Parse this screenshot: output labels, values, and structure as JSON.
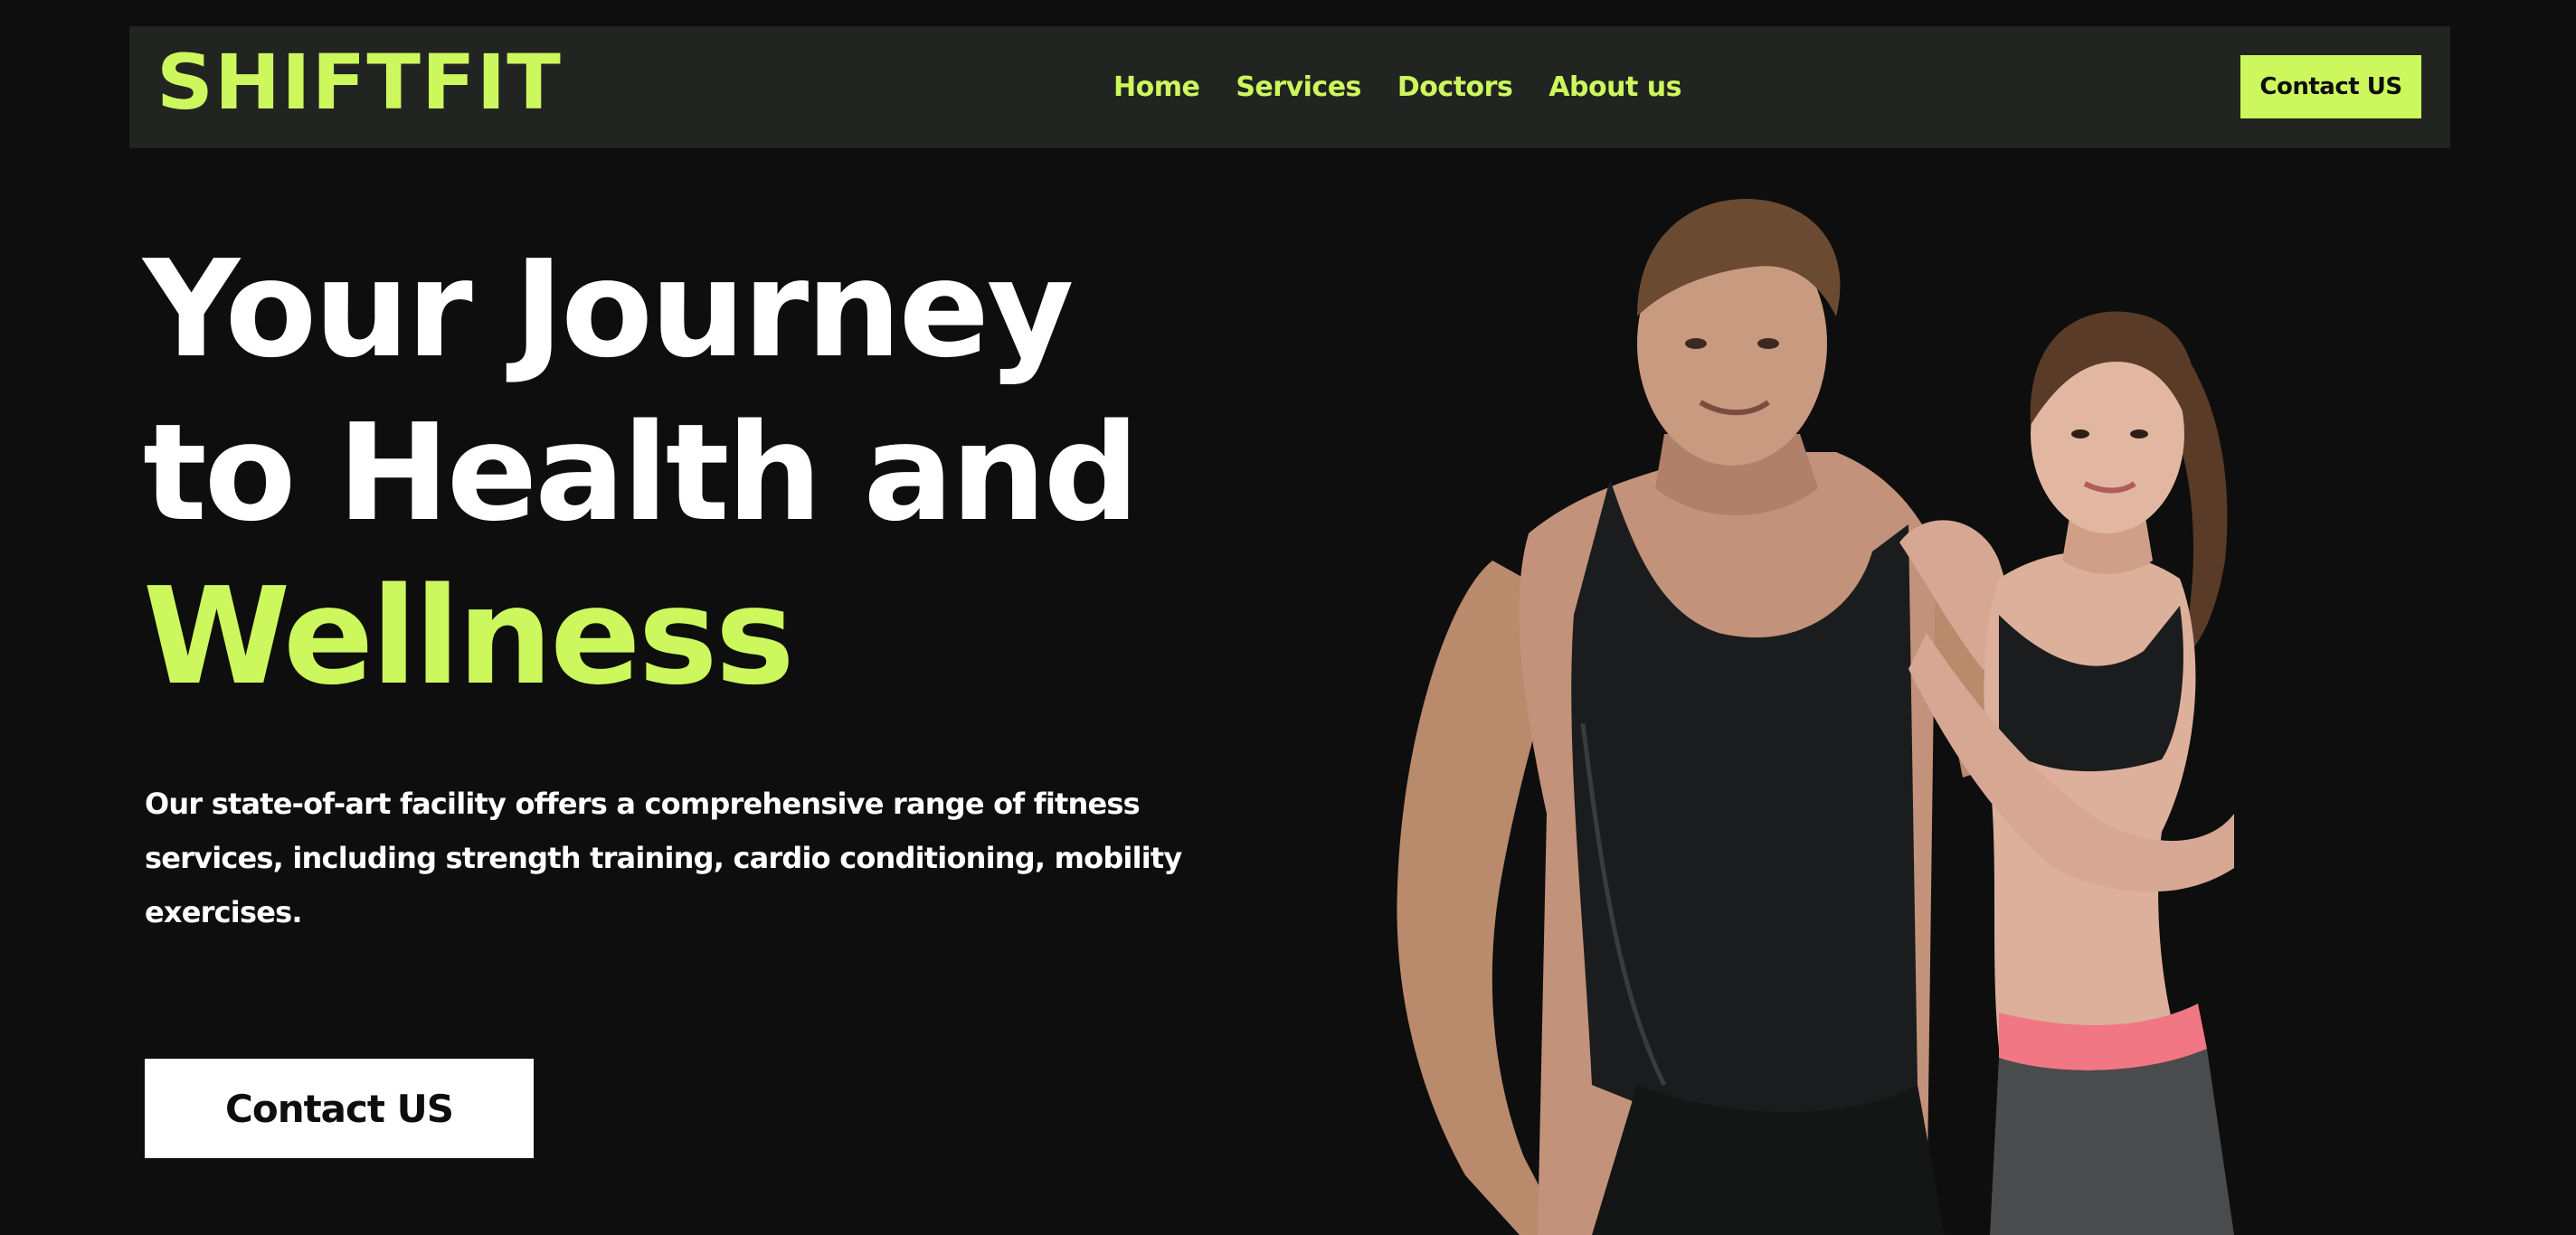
{
  "header": {
    "logo": "SHIFTFIT",
    "nav": [
      {
        "label": "Home"
      },
      {
        "label": "Services"
      },
      {
        "label": "Doctors"
      },
      {
        "label": "About us"
      }
    ],
    "cta_label": "Contact US"
  },
  "hero": {
    "title_line1": "Your Journey",
    "title_line2": "to Health and",
    "title_accent": "Wellness",
    "description": "Our state-of-art facility offers a comprehensive range of fitness services, including strength training, cardio conditioning, mobility exercises.",
    "cta_label": "Contact US"
  },
  "colors": {
    "background": "#0d0e0d",
    "navbar": "#222421",
    "accent": "#cdf85d",
    "text": "#ffffff"
  }
}
